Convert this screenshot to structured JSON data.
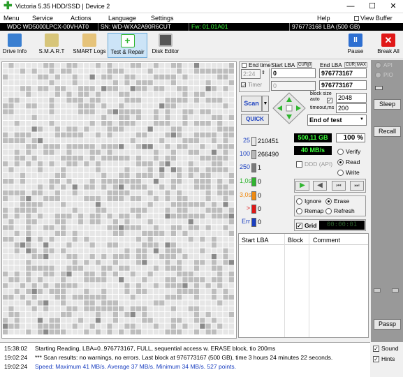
{
  "window": {
    "title": "Victoria 5.35 HDD/SSD | Device 2",
    "minimize": "—",
    "maximize": "☐",
    "close": "✕"
  },
  "menu": {
    "items": [
      "Menu",
      "Service",
      "Actions",
      "Language",
      "Settings",
      "Help"
    ],
    "view_buffer": "View Buffer Live"
  },
  "device": {
    "model": "WDC WD5000LPCX-00VHAT0",
    "serial": "SN: WD-WXA2A90R6CUT",
    "firmware": "Fw: 01.01A01",
    "capacity": "976773168 LBA (500 GB)"
  },
  "toolbar": {
    "drive_info": "Drive Info",
    "smart": "S.M.A.R.T",
    "smart_logs": "SMART Logs",
    "test_repair": "Test & Repair",
    "disk_editor": "Disk Editor",
    "pause": "Pause",
    "break_all": "Break All"
  },
  "scan": {
    "end_time_label": "End time",
    "end_time_value": "2:24",
    "timer_label": "Timer",
    "timer_value": "0",
    "start_lba_label": "Start LBA",
    "start_lba_value": "0",
    "start_lba_value2": "0",
    "cur_label": "CUR",
    "end_lba_label": "End LBA",
    "max_label": "MAX",
    "end_lba_value": "976773167",
    "end_lba_value2": "976773167",
    "block_size_label": "block size",
    "auto_label": "auto",
    "block_size_value": "2048",
    "timeout_label": "timeout,ms",
    "timeout_value": "200",
    "scan_button": "Scan",
    "quick_button": "QUICK",
    "end_of_test": "End of test"
  },
  "legend": [
    {
      "label": "25",
      "count": "210451",
      "color": "#e8e8e8"
    },
    {
      "label": "100",
      "count": "266490",
      "color": "#b8b8b8"
    },
    {
      "label": "250",
      "count": "1",
      "color": "#7a7a7a"
    },
    {
      "label": "1,0s",
      "count": "0",
      "color": "#2fb52f"
    },
    {
      "label": "3,0s",
      "count": "0",
      "color": "#f08a10"
    },
    {
      "label": ">",
      "count": "0",
      "color": "#e01818"
    },
    {
      "label": "Err",
      "count": "0",
      "color": "#1a3fc0"
    }
  ],
  "stats": {
    "size": "500,11 GB",
    "percent": "100",
    "percent_unit": "%",
    "speed": "40 MB/s",
    "ddd_label": "DDD (API)",
    "verify": "Verify",
    "read": "Read",
    "write": "Write",
    "ignore": "Ignore",
    "erase": "Erase",
    "remap": "Remap",
    "refresh": "Refresh",
    "grid_label": "Grid",
    "timer_display": "00:00:01"
  },
  "table": {
    "headers": [
      "Start LBA",
      "Block",
      "Comment"
    ]
  },
  "side": {
    "api": "API",
    "pio": "PIO",
    "sleep": "Sleep",
    "recall": "Recall",
    "passp": "Passp",
    "sound": "Sound",
    "hints": "Hints"
  },
  "log": [
    {
      "time": "15:38:02",
      "text": "Starting Reading, LBA=0..976773167, FULL, sequential access w. ERASE block, tio 200ms",
      "color": "#000000"
    },
    {
      "time": "19:02:24",
      "text": "*** Scan results: no warnings, no errors. Last block at 976773167 (500 GB), time 3 hours 24 minutes 22 seconds.",
      "color": "#000000"
    },
    {
      "time": "19:02:24",
      "text": "Speed: Maximum 41 MB/s. Average 37 MB/s. Minimum 34 MB/s. 527 points.",
      "color": "#1a3fc0"
    }
  ],
  "colors": {
    "accent_green": "#2fb52f",
    "break_red": "#e01818",
    "pause_blue": "#2e6fd1",
    "display_bg": "#000000",
    "display_fg": "#3cff3c"
  }
}
